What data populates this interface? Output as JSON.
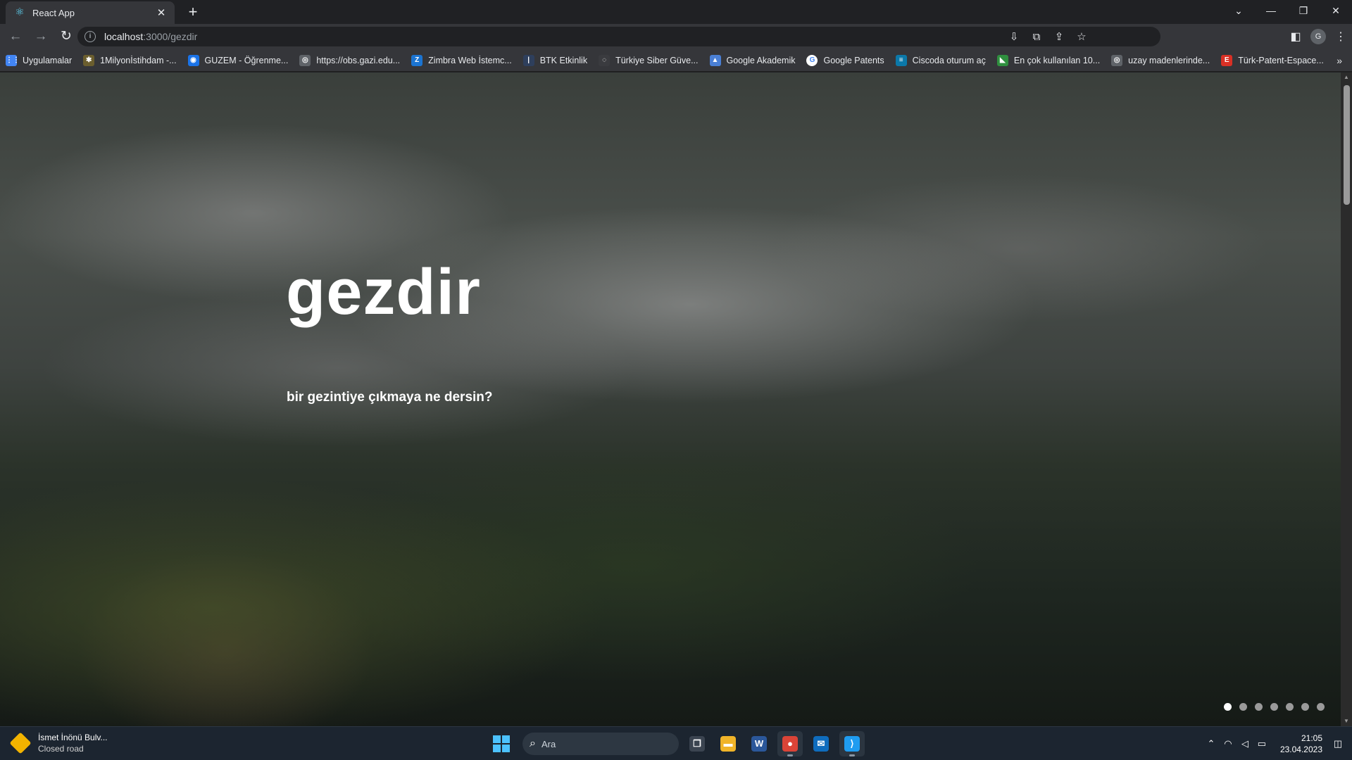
{
  "browser": {
    "tab_title": "React App",
    "new_tab_label": "+",
    "url_host": "localhost",
    "url_path": ":3000/gezdir",
    "profile_initial": "G"
  },
  "bookmarks": [
    {
      "label": "Uygulamalar",
      "icon": "apps-grid-icon",
      "color": "#4285f4",
      "glyph": "⋮⋮"
    },
    {
      "label": "1Milyonİstihdam -...",
      "icon": "star-icon",
      "color": "#6b5e2e",
      "glyph": "✱"
    },
    {
      "label": "GUZEM - Öğrenme...",
      "icon": "guzem-icon",
      "color": "#1a73e8",
      "glyph": "◉"
    },
    {
      "label": "https://obs.gazi.edu...",
      "icon": "globe-icon",
      "color": "#5f6368",
      "glyph": "◎"
    },
    {
      "label": "Zimbra Web İstemc...",
      "icon": "zimbra-icon",
      "color": "#1b74d1",
      "glyph": "Z"
    },
    {
      "label": "BTK Etkinlik",
      "icon": "btk-icon",
      "color": "#2e3f5c",
      "glyph": "|"
    },
    {
      "label": "Türkiye Siber Güve...",
      "icon": "siber-icon",
      "color": "#3a3b3f",
      "glyph": "◌"
    },
    {
      "label": "Google Akademik",
      "icon": "graduation-cap-icon",
      "color": "#4a7fd4",
      "glyph": "▲"
    },
    {
      "label": "Google Patents",
      "icon": "google-icon",
      "color": "#ffffff",
      "glyph": "G"
    },
    {
      "label": "Ciscoda oturum aç",
      "icon": "cisco-icon",
      "color": "#0b78a9",
      "glyph": "≡"
    },
    {
      "label": "En çok kullanılan 10...",
      "icon": "chart-icon",
      "color": "#2f8f3f",
      "glyph": "◣"
    },
    {
      "label": "uzay madenlerinde...",
      "icon": "globe-icon",
      "color": "#5f6368",
      "glyph": "◎"
    },
    {
      "label": "Türk-Patent-Espace...",
      "icon": "patent-icon",
      "color": "#d93025",
      "glyph": "E"
    }
  ],
  "bookmarks_more": "»",
  "hero": {
    "title": "gezdir",
    "subtitle": "bir gezintiye çıkmaya ne dersin?"
  },
  "carousel": {
    "slide_count": 7,
    "active_index": 0
  },
  "taskbar": {
    "widget_title": "İsmet İnönü Bulv...",
    "widget_subtitle": "Closed road",
    "search_placeholder": "Ara",
    "clock_time": "21:05",
    "clock_date": "23.04.2023",
    "apps": [
      {
        "name": "task-view-icon",
        "glyph": "❐",
        "color": "#3b4450",
        "active": false
      },
      {
        "name": "file-explorer-icon",
        "glyph": "▬",
        "color": "#f0b429",
        "active": false
      },
      {
        "name": "word-icon",
        "glyph": "W",
        "color": "#2b579a",
        "active": false
      },
      {
        "name": "chrome-icon",
        "glyph": "●",
        "color": "#db4437",
        "active": true
      },
      {
        "name": "mail-icon",
        "glyph": "✉",
        "color": "#0f6cbd",
        "active": false
      },
      {
        "name": "vscode-icon",
        "glyph": "⟩",
        "color": "#1f9cf0",
        "active": true
      }
    ]
  }
}
